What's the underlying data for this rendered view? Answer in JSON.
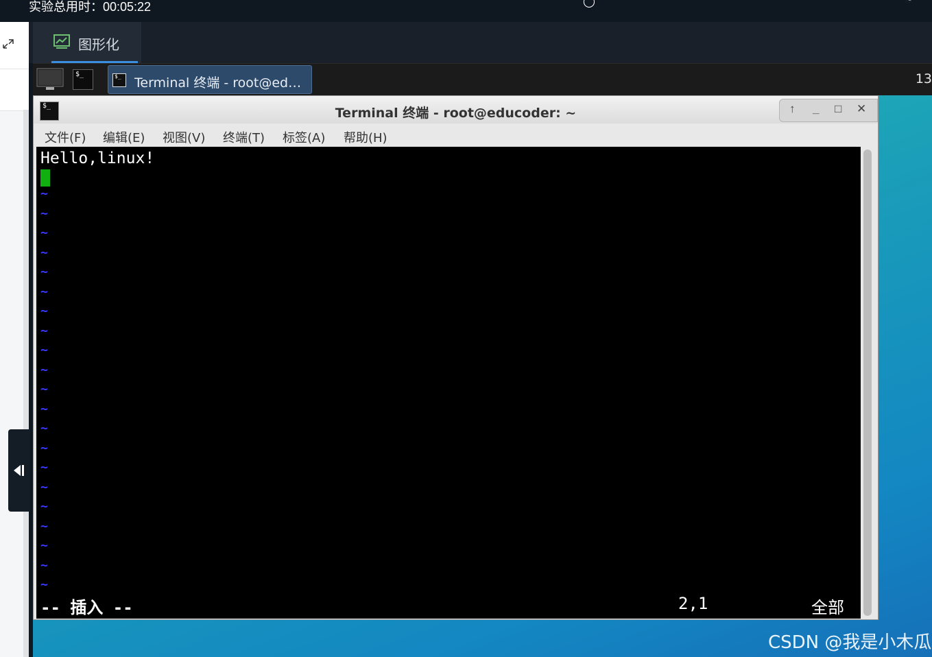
{
  "top_bar": {
    "timer": "实验总用时：00:05:22"
  },
  "tabs": [
    {
      "label": "图形化",
      "icon": "chart-icon",
      "active": true
    }
  ],
  "panel": {
    "task_label": "Terminal 终端 - root@ed…",
    "clock": "13"
  },
  "window": {
    "title": "Terminal 终端 - root@educoder: ~",
    "menu": [
      "文件(F)",
      "编辑(E)",
      "视图(V)",
      "终端(T)",
      "标签(A)",
      "帮助(H)"
    ],
    "controls": [
      "↑",
      "_",
      "□",
      "✕"
    ]
  },
  "terminal": {
    "line1": "Hello,linux!",
    "tilde_char": "~",
    "mode": "-- 插入 --",
    "position": "2,1",
    "scope": "全部"
  },
  "watermark": "CSDN @我是小木瓜",
  "colors": {
    "accent": "#3b8fe0",
    "cursor": "#10b010",
    "tilde": "#3a3aff"
  }
}
